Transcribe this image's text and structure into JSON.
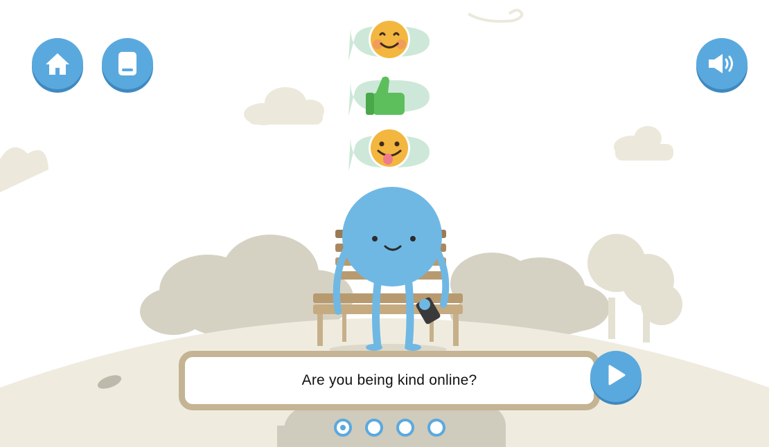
{
  "toolbar": {
    "home_icon": "home-icon",
    "book_icon": "book-icon",
    "sound_icon": "speaker-icon"
  },
  "reactions": [
    {
      "icon": "smiling-face-emoji"
    },
    {
      "icon": "thumbs-up-emoji"
    },
    {
      "icon": "tongue-out-face-emoji"
    }
  ],
  "dialog": {
    "text": "Are you being kind online?",
    "next_icon": "play-icon"
  },
  "pagination": {
    "count": 4,
    "active_index": 0
  },
  "colors": {
    "button_blue": "#5aa9de",
    "character_blue": "#6fb8e4",
    "ground": "#efecdf",
    "bush": "#cfcbbd",
    "bench_wood": "#b89a70",
    "dialog_border": "#c4b494"
  }
}
